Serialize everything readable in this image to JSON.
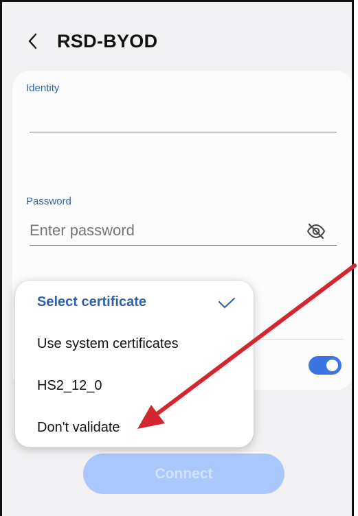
{
  "header": {
    "back_icon": "chevron-left-icon",
    "title": "RSD-BYOD"
  },
  "form": {
    "identity": {
      "label": "Identity",
      "value": ""
    },
    "password": {
      "label": "Password",
      "placeholder": "Enter password",
      "value": "",
      "visibility_icon": "eye-off-icon"
    },
    "toggle": {
      "state": "on"
    },
    "connect_label": "Connect"
  },
  "dropdown": {
    "selected_index": 0,
    "options": [
      "Select certificate",
      "Use system certificates",
      "HS2_12_0",
      "Don't validate"
    ],
    "check_icon": "check-icon"
  },
  "annotation": {
    "color": "#d3262f"
  },
  "colors": {
    "accent": "#2f62a7",
    "toggle_on": "#3a75e1",
    "button_disabled": "#a9c9fc",
    "background": "#f2f2f4"
  }
}
